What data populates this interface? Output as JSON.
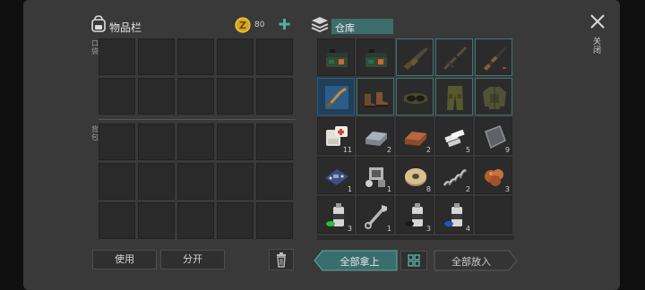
{
  "inventory": {
    "title": "物品栏",
    "coins": "80",
    "pocket_label": "口袋",
    "backpack_label": "背包"
  },
  "storage": {
    "title": "仓库"
  },
  "close_label": "关闭",
  "buttons": {
    "use": "使用",
    "split": "分开",
    "take_all": "全部拿上",
    "put_all": "全部放入"
  },
  "storage_items": [
    {
      "icon": "ammo-box-icon",
      "qty": ""
    },
    {
      "icon": "ammo-box-icon",
      "qty": ""
    },
    {
      "icon": "assault-rifle-icon",
      "qty": ""
    },
    {
      "icon": "crossbow-icon",
      "qty": ""
    },
    {
      "icon": "rifle-icon",
      "qty": ""
    },
    {
      "icon": "blueprint-icon",
      "qty": ""
    },
    {
      "icon": "boots-icon",
      "qty": ""
    },
    {
      "icon": "goggles-icon",
      "qty": ""
    },
    {
      "icon": "pants-icon",
      "qty": ""
    },
    {
      "icon": "jacket-icon",
      "qty": ""
    },
    {
      "icon": "bandage-icon",
      "qty": "11"
    },
    {
      "icon": "iron-ingot-icon",
      "qty": "2"
    },
    {
      "icon": "copper-ingot-icon",
      "qty": "2"
    },
    {
      "icon": "bars-icon",
      "qty": "5"
    },
    {
      "icon": "plate-icon",
      "qty": "9"
    },
    {
      "icon": "circuit-board-icon",
      "qty": "1"
    },
    {
      "icon": "engine-part-icon",
      "qty": "1"
    },
    {
      "icon": "wire-spool-icon",
      "qty": "8"
    },
    {
      "icon": "spring-icon",
      "qty": "2"
    },
    {
      "icon": "ore-chunk-icon",
      "qty": "3"
    },
    {
      "icon": "paint-can-green-icon",
      "qty": "3"
    },
    {
      "icon": "wrench-icon",
      "qty": "1"
    },
    {
      "icon": "paint-can-black-icon",
      "qty": "3"
    },
    {
      "icon": "paint-can-blue-icon",
      "qty": "4"
    },
    {
      "icon": "empty-slot",
      "qty": ""
    }
  ]
}
